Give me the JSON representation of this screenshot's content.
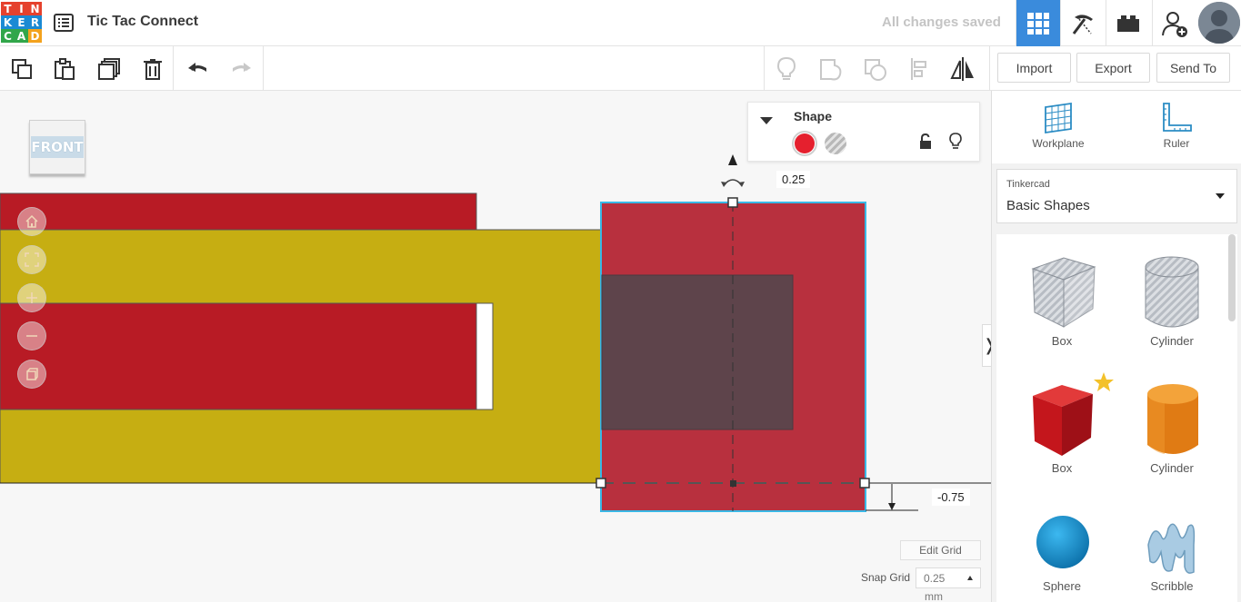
{
  "app": {
    "logo_letters": [
      "T",
      "I",
      "N",
      "K",
      "E",
      "R",
      "C",
      "A",
      "D"
    ],
    "logo_colors": [
      "#e5412d",
      "#e5412d",
      "#e5412d",
      "#1a8ad4",
      "#1a8ad4",
      "#1a8ad4",
      "#31a64a",
      "#31a64a",
      "#f3a21d"
    ],
    "title": "Tic Tac Connect",
    "save_status": "All changes saved"
  },
  "topbar": {
    "buttons": [
      "grid-view-icon",
      "pickaxe-icon",
      "bricks-icon",
      "add-user-icon"
    ]
  },
  "toolbar": {
    "tools": [
      "copy-icon",
      "paste-icon",
      "duplicate-icon",
      "delete-icon",
      "undo-icon",
      "redo-icon"
    ],
    "view_tools": [
      "light-icon",
      "group-icon",
      "ungroup-icon",
      "align-icon",
      "mirror-icon"
    ],
    "import_label": "Import",
    "export_label": "Export",
    "send_to_label": "Send To"
  },
  "canvas": {
    "view_label": "FRONT",
    "nav": [
      "home-icon",
      "fit-icon",
      "zoom-in-icon",
      "zoom-out-icon",
      "perspective-icon"
    ],
    "shape_panel": {
      "title": "Shape",
      "solid_color": "#e5202e",
      "hole_option": "hole"
    },
    "top_dimension": "0.25",
    "side_dimension": "-0.75",
    "edit_grid_label": "Edit Grid",
    "snap_grid_label": "Snap Grid",
    "snap_grid_value": "0.25",
    "snap_grid_unit": "mm"
  },
  "right_panel": {
    "workplane_label": "Workplane",
    "ruler_label": "Ruler",
    "library_category": "Tinkercad",
    "library_name": "Basic Shapes",
    "shapes": [
      {
        "label": "Box",
        "kind": "box-hole"
      },
      {
        "label": "Cylinder",
        "kind": "cylinder-hole"
      },
      {
        "label": "Box",
        "kind": "box-red"
      },
      {
        "label": "Cylinder",
        "kind": "cylinder-orange"
      },
      {
        "label": "Sphere",
        "kind": "sphere-blue"
      },
      {
        "label": "Scribble",
        "kind": "scribble"
      }
    ]
  }
}
